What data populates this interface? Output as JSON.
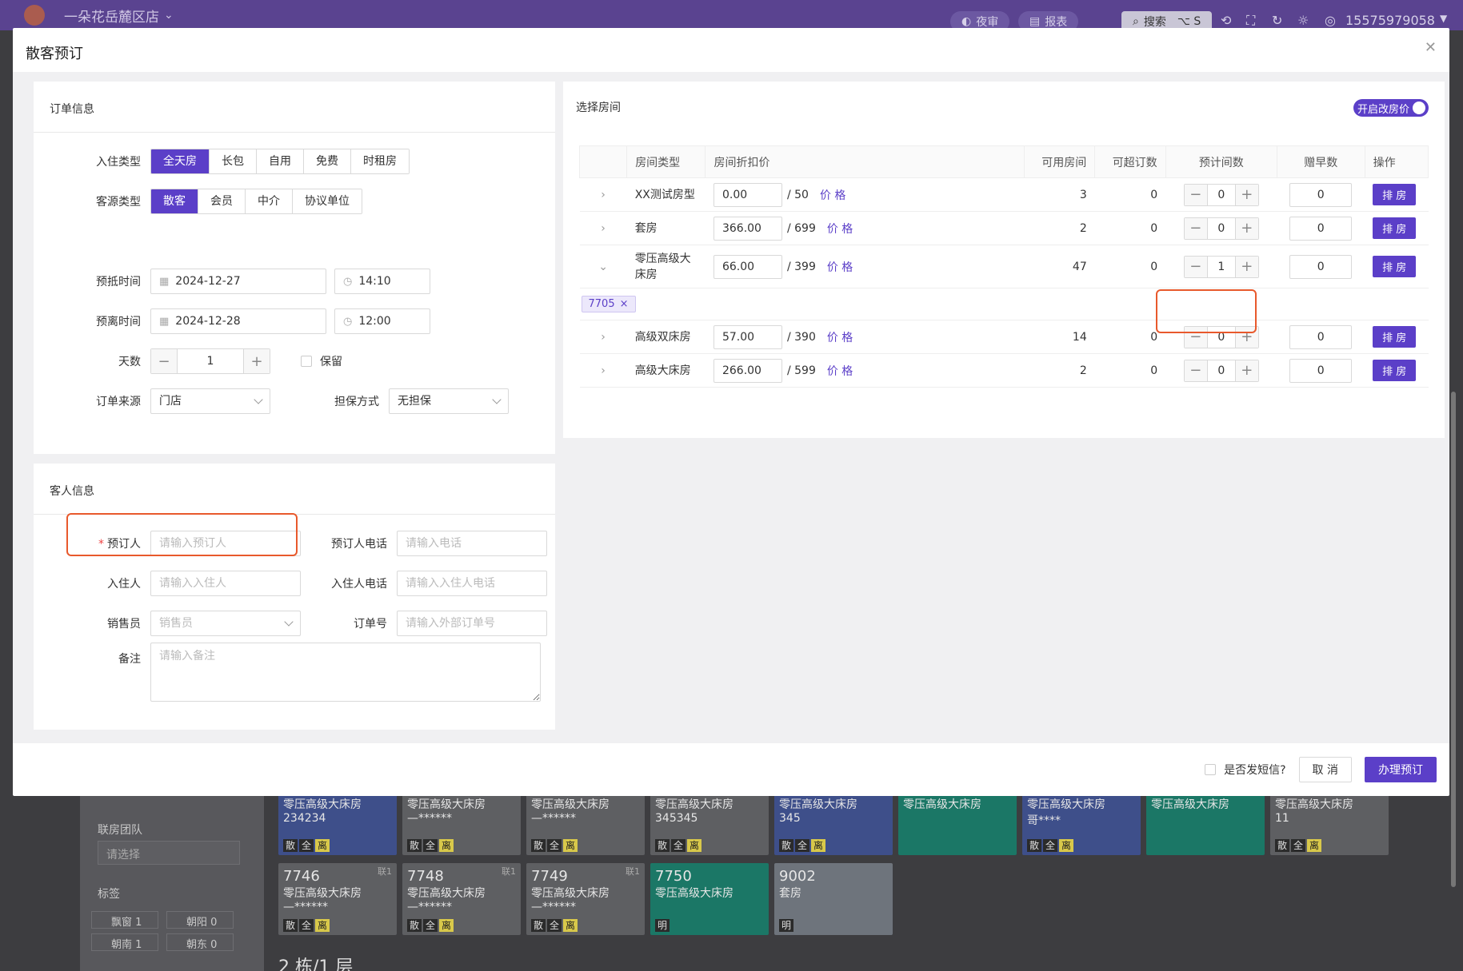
{
  "app": {
    "store_name": "一朵花岳麓区店",
    "night_audit": "夜审",
    "report": "报表",
    "search": "搜索",
    "search_shortcut": "⌥ S",
    "phone": "15575979058"
  },
  "background": {
    "group_label": "联房团队",
    "group_placeholder": "请选择",
    "tags_label": "标签",
    "tags": [
      "飘窗 1",
      "朝阳 0",
      "朝南 1",
      "朝东 0"
    ],
    "tiles_row1": [
      {
        "type": "零压高级大床房",
        "sub": "234234",
        "color": "blue",
        "badges": [
          "散",
          "全",
          "离"
        ]
      },
      {
        "type": "零压高级大床房",
        "sub": "—******",
        "color": "gray",
        "badges": [
          "散",
          "全",
          "离"
        ]
      },
      {
        "type": "零压高级大床房",
        "sub": "—******",
        "color": "gray",
        "badges": [
          "散",
          "全",
          "离"
        ]
      },
      {
        "type": "零压高级大床房",
        "sub": "345345",
        "color": "gray",
        "badges": [
          "散",
          "全",
          "离"
        ]
      },
      {
        "type": "零压高级大床房",
        "sub": "345",
        "color": "blue",
        "badges": [
          "散",
          "全",
          "离"
        ]
      },
      {
        "type": "零压高级大床房",
        "sub": "",
        "color": "green",
        "badges": []
      },
      {
        "type": "零压高级大床房",
        "sub": "哥****",
        "color": "blue",
        "badges": [
          "散",
          "全",
          "离"
        ]
      },
      {
        "type": "零压高级大床房",
        "sub": "",
        "color": "green",
        "badges": []
      },
      {
        "type": "零压高级大床房",
        "sub": "11",
        "color": "gray",
        "badges": [
          "散",
          "全",
          "离"
        ]
      }
    ],
    "tiles_row2": [
      {
        "no": "7746",
        "corner": "联1",
        "type": "零压高级大床房",
        "sub": "—******",
        "color": "gray",
        "badges": [
          "散",
          "全",
          "离"
        ]
      },
      {
        "no": "7748",
        "corner": "联1",
        "type": "零压高级大床房",
        "sub": "—******",
        "color": "gray",
        "badges": [
          "散",
          "全",
          "离"
        ]
      },
      {
        "no": "7749",
        "corner": "联1",
        "type": "零压高级大床房",
        "sub": "—******",
        "color": "gray",
        "badges": [
          "散",
          "全",
          "离"
        ]
      },
      {
        "no": "7750",
        "corner": "",
        "type": "零压高级大床房",
        "sub": "",
        "color": "green",
        "badges": [
          "明"
        ]
      },
      {
        "no": "9002",
        "corner": "",
        "type": "套房",
        "sub": "",
        "color": "lgray",
        "badges": [
          "明"
        ]
      }
    ],
    "floor_label": "2 栋/1 层"
  },
  "modal": {
    "title": "散客预订",
    "order_section": {
      "title": "订单信息",
      "checkin_type_label": "入住类型",
      "checkin_types": [
        "全天房",
        "长包",
        "自用",
        "免费",
        "时租房"
      ],
      "checkin_type_selected": 0,
      "source_type_label": "客源类型",
      "source_types": [
        "散客",
        "会员",
        "中介",
        "协议单位"
      ],
      "source_type_selected": 0,
      "arrive_label": "预抵时间",
      "arrive_date": "2024-12-27",
      "arrive_time": "14:10",
      "leave_label": "预离时间",
      "leave_date": "2024-12-28",
      "leave_time": "12:00",
      "days_label": "天数",
      "days": "1",
      "reserve_label": "保留",
      "order_source_label": "订单来源",
      "order_source": "门店",
      "guarantee_label": "担保方式",
      "guarantee": "无担保"
    },
    "guest_section": {
      "title": "客人信息",
      "booker_label": "预订人",
      "booker_placeholder": "请输入预订人",
      "booker_phone_label": "预订人电话",
      "booker_phone_placeholder": "请输入电话",
      "guest_label": "入住人",
      "guest_placeholder": "请输入入住人",
      "guest_phone_label": "入住人电话",
      "guest_phone_placeholder": "请输入入住人电话",
      "sales_label": "销售员",
      "sales_placeholder": "销售员",
      "order_no_label": "订单号",
      "order_no_placeholder": "请输入外部订单号",
      "remark_label": "备注",
      "remark_placeholder": "请输入备注"
    },
    "room_section": {
      "title": "选择房间",
      "toggle_label": "开启改房价",
      "columns": [
        "房间类型",
        "房间折扣价",
        "可用房间",
        "可超订数",
        "预计间数",
        "赠早数",
        "操作"
      ],
      "price_link": "价 格",
      "action_label": "排 房",
      "rows": [
        {
          "type": "XX测试房型",
          "price": "0.00",
          "base": "/ 50",
          "avail": "3",
          "over": "0",
          "count": "0",
          "breakfast": "0"
        },
        {
          "type": "套房",
          "price": "366.00",
          "base": "/ 699",
          "avail": "2",
          "over": "0",
          "count": "0",
          "breakfast": "0"
        },
        {
          "type": "零压高级大床房",
          "price": "66.00",
          "base": "/ 399",
          "avail": "47",
          "over": "0",
          "count": "1",
          "breakfast": "0"
        },
        {
          "type": "高级双床房",
          "price": "57.00",
          "base": "/ 390",
          "avail": "14",
          "over": "0",
          "count": "0",
          "breakfast": "0"
        },
        {
          "type": "高级大床房",
          "price": "266.00",
          "base": "/ 599",
          "avail": "2",
          "over": "0",
          "count": "0",
          "breakfast": "0"
        }
      ],
      "assigned_room": "7705"
    },
    "footer": {
      "sms_label": "是否发短信?",
      "cancel": "取 消",
      "submit": "办理预订"
    }
  },
  "colors": {
    "primary": "#5b3fc8",
    "highlight": "#e8592c",
    "topbar": "#5a4390"
  }
}
